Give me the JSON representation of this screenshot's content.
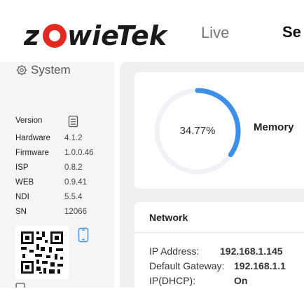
{
  "header": {
    "logo_text": "zowieTek",
    "nav": {
      "live": "Live",
      "settings": "Se"
    }
  },
  "sidebar": {
    "section_title": "System",
    "info": [
      {
        "key": "Version",
        "value": ""
      },
      {
        "key": "Hardware",
        "value": "4.1.2"
      },
      {
        "key": "Firmware",
        "value": "1.0.0.46"
      },
      {
        "key": "ISP",
        "value": "0.8.2"
      },
      {
        "key": "WEB",
        "value": "0.9.41"
      },
      {
        "key": "NDI",
        "value": "5.5.4"
      },
      {
        "key": "SN",
        "value": "12066"
      }
    ]
  },
  "memory": {
    "percent_text": "34.77%",
    "fraction": 0.3477,
    "label": "Memory",
    "accent": "#3d8fe8",
    "track": "#f1f2f6"
  },
  "network": {
    "title": "Network",
    "rows": [
      {
        "key": "IP Address:",
        "value": "192.168.1.145"
      },
      {
        "key": "Default Gateway:",
        "value": "192.168.1.1"
      },
      {
        "key": "IP(DHCP):",
        "value": "On"
      }
    ]
  },
  "colors": {
    "brand": "#1a1a1a",
    "logo_accent": "#e02a22",
    "sidebar_bg": "#f5f5f5",
    "main_bg": "#efefef"
  },
  "icons": [
    "gear-icon",
    "document-icon",
    "qr-code",
    "phone-icon"
  ]
}
